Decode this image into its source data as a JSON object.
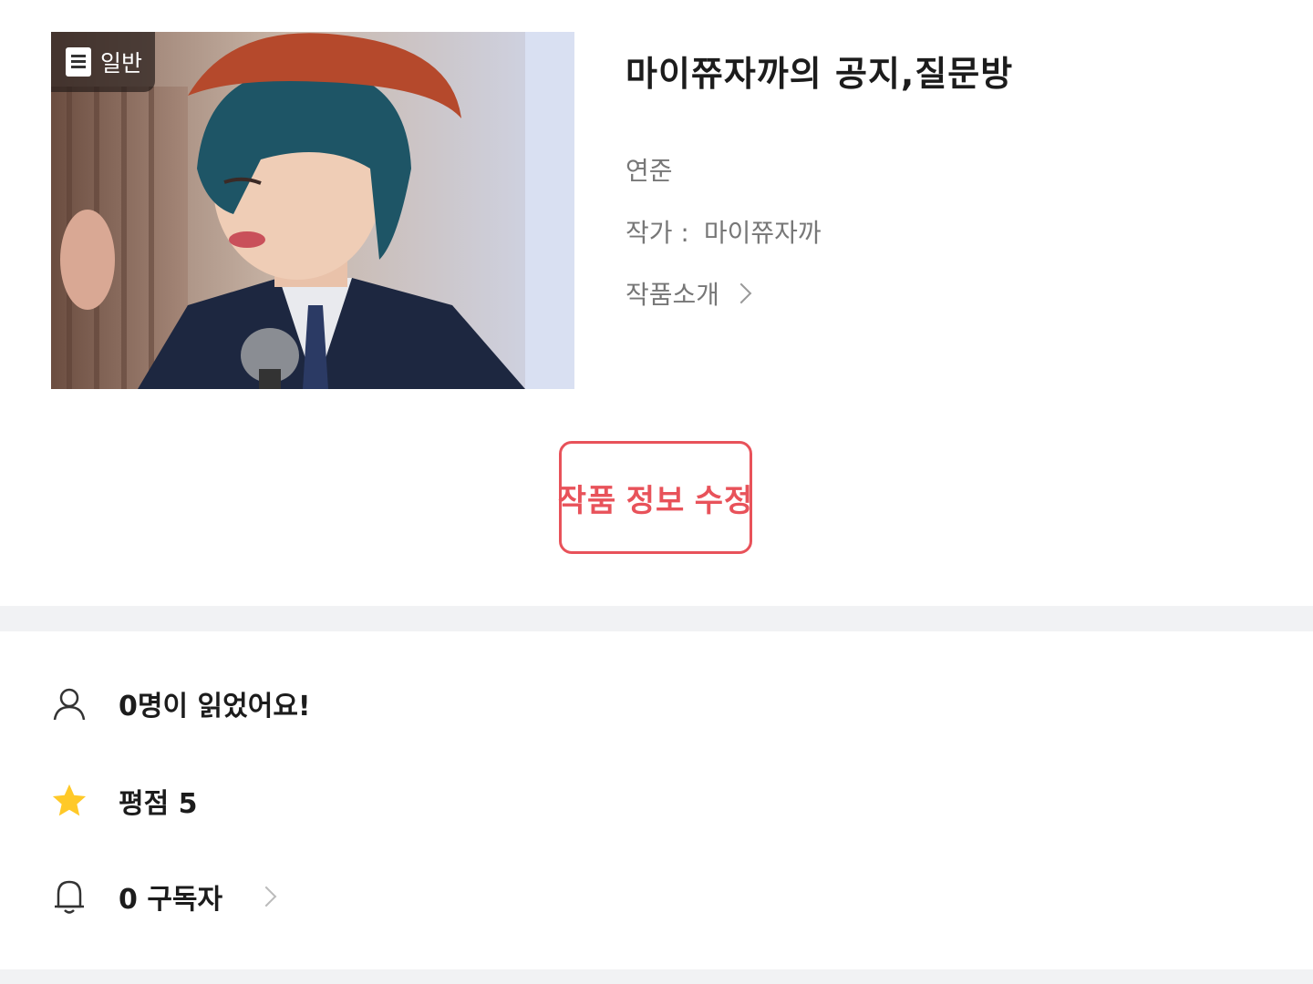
{
  "work": {
    "genre_badge": "일반",
    "title": "마이쮸자까의 공지,질문방",
    "genre": "연준",
    "author_label": "작가 :",
    "author_name": "마이쮸자까",
    "intro_label": "작품소개"
  },
  "actions": {
    "edit_label": "작품 정보 수정"
  },
  "stats": {
    "readers": "0명이 읽었어요!",
    "rating": "평점 5",
    "subscribers": "0 구독자"
  },
  "colors": {
    "accent": "#e8525a",
    "star": "#ffc928",
    "divider": "#f1f2f4"
  },
  "icons": {
    "genre": "document-icon",
    "intro": "chevron-right-icon",
    "readers": "person-icon",
    "rating": "star-icon",
    "subscribers": "bell-icon"
  }
}
